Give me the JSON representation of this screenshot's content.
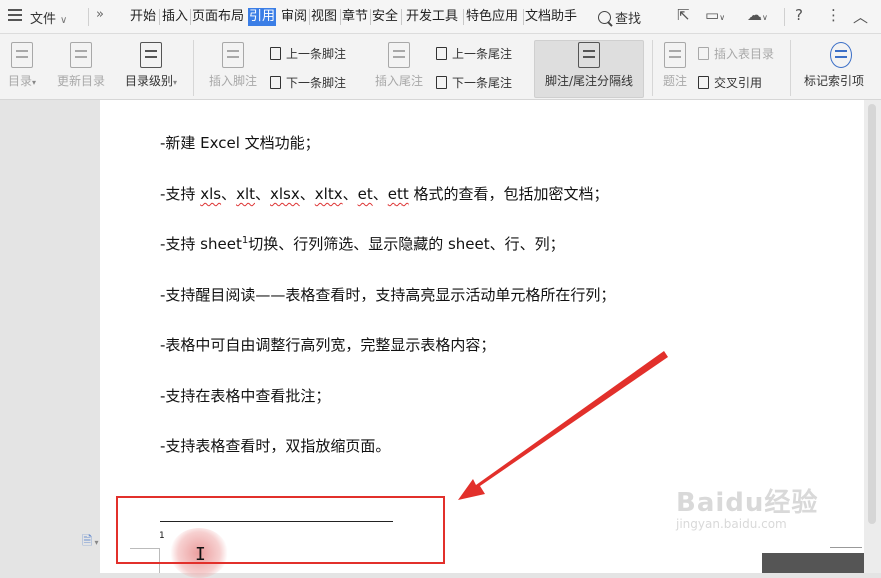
{
  "menubar": {
    "file_label": "文件",
    "tabs": [
      "开始",
      "插入",
      "页面布局",
      "引用",
      "审阅",
      "视图",
      "章节",
      "安全",
      "开发工具",
      "特色应用",
      "文档助手"
    ],
    "active_tab": "引用",
    "search_label": "查找",
    "help_label": "?"
  },
  "ribbon": {
    "toc": "目录",
    "update_toc": "更新目录",
    "toc_level": "目录级别",
    "insert_footnote": "插入脚注",
    "prev_footnote": "上一条脚注",
    "next_footnote": "下一条脚注",
    "insert_endnote": "插入尾注",
    "prev_endnote": "上一条尾注",
    "next_endnote": "下一条尾注",
    "separator": "脚注/尾注分隔线",
    "caption": "题注",
    "insert_table_of_figures": "插入表目录",
    "cross_reference": "交叉引用",
    "mark_index": "标记索引项"
  },
  "document": {
    "lines": [
      "-新建 Excel 文档功能；",
      "-支持 xls、xlt、xlsx、xltx、et、ett 格式的查看，包括加密文档；",
      "-支持 sheet",
      "-支持醒目阅读——表格查看时，支持高亮显示活动单元格所在行列；",
      "-表格中可自由调整行高列宽，完整显示表格内容；",
      "-支持在表格中查看批注；",
      "-支持表格查看时，双指放缩页面。"
    ],
    "line2_parts": [
      "-支持 ",
      "xls",
      "、",
      "xlt",
      "、",
      "xlsx",
      "、",
      "xltx",
      "、",
      "et",
      "、",
      "ett",
      " 格式的查看，包括加密文档；"
    ],
    "line3_sup": "1",
    "line3_rest": "切换、行列筛选、显示隐藏的 sheet、行、列；",
    "footnote_number": "1"
  },
  "watermark": {
    "brand": "Baidu经验",
    "url": "jingyan.baidu.com"
  },
  "colors": {
    "active_tab": "#3b7ee6",
    "annotation_red": "#e2302b"
  }
}
